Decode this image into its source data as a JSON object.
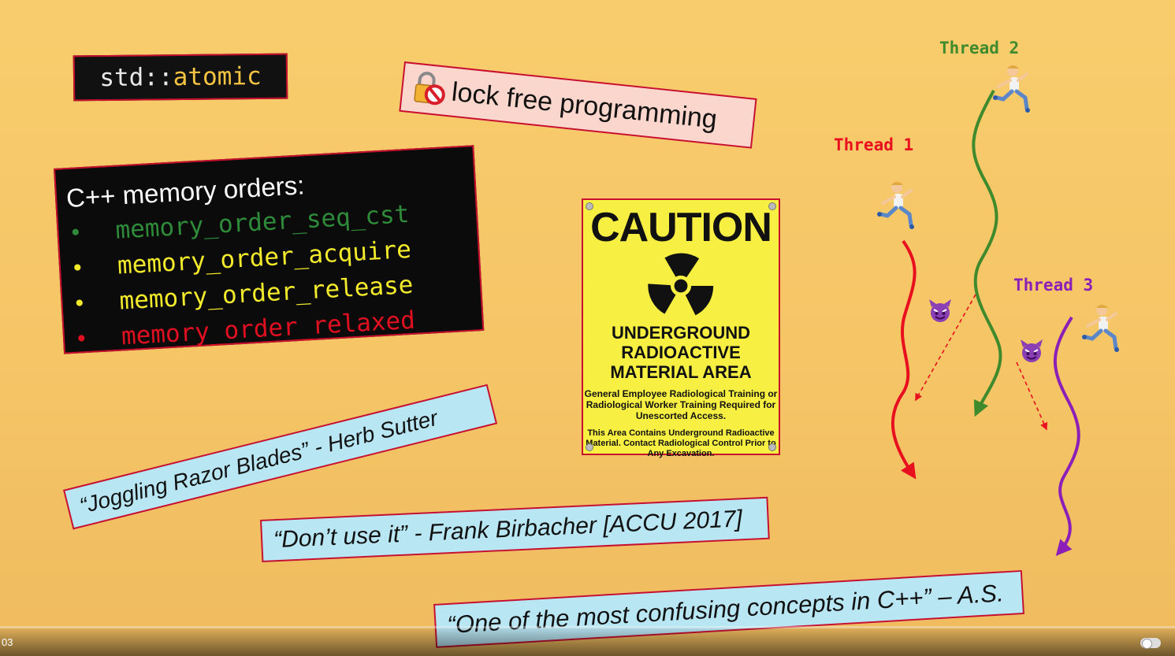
{
  "atomic": {
    "namespace": "std::",
    "keyword": "atomic"
  },
  "lockfree": {
    "text": "lock free programming",
    "icon": "locked-prohibited-icon"
  },
  "memory_orders": {
    "title": "C++ memory orders:",
    "items": [
      {
        "text": "memory_order_seq_cst",
        "color": "#2e8b3a"
      },
      {
        "text": "memory_order_acquire",
        "color": "#f2ea2b"
      },
      {
        "text": "memory_order_release",
        "color": "#f2ea2b"
      },
      {
        "text": "memory_order_relaxed",
        "color": "#e01020"
      }
    ]
  },
  "caution": {
    "title": "CAUTION",
    "area_lines": [
      "UNDERGROUND",
      "RADIOACTIVE",
      "MATERIAL AREA"
    ],
    "paragraph1": "General Employee Radiological Training or Radiological Worker Training Required for Unescorted Access.",
    "paragraph2": "This Area Contains Underground Radioactive Material. Contact Radiological Control Prior to Any Excavation.",
    "icon": "radiation-icon"
  },
  "quotes": [
    "“Joggling Razor Blades” - Herb Sutter",
    "“Don’t use it” - Frank Birbacher [ACCU 2017]",
    "“One of the most confusing concepts in C++” – A.S."
  ],
  "threads": [
    {
      "label": "Thread 1",
      "color": "#e8101e"
    },
    {
      "label": "Thread 2",
      "color": "#3f8a2c"
    },
    {
      "label": "Thread 3",
      "color": "#8c1fb8"
    }
  ],
  "video": {
    "timecode": "03"
  }
}
